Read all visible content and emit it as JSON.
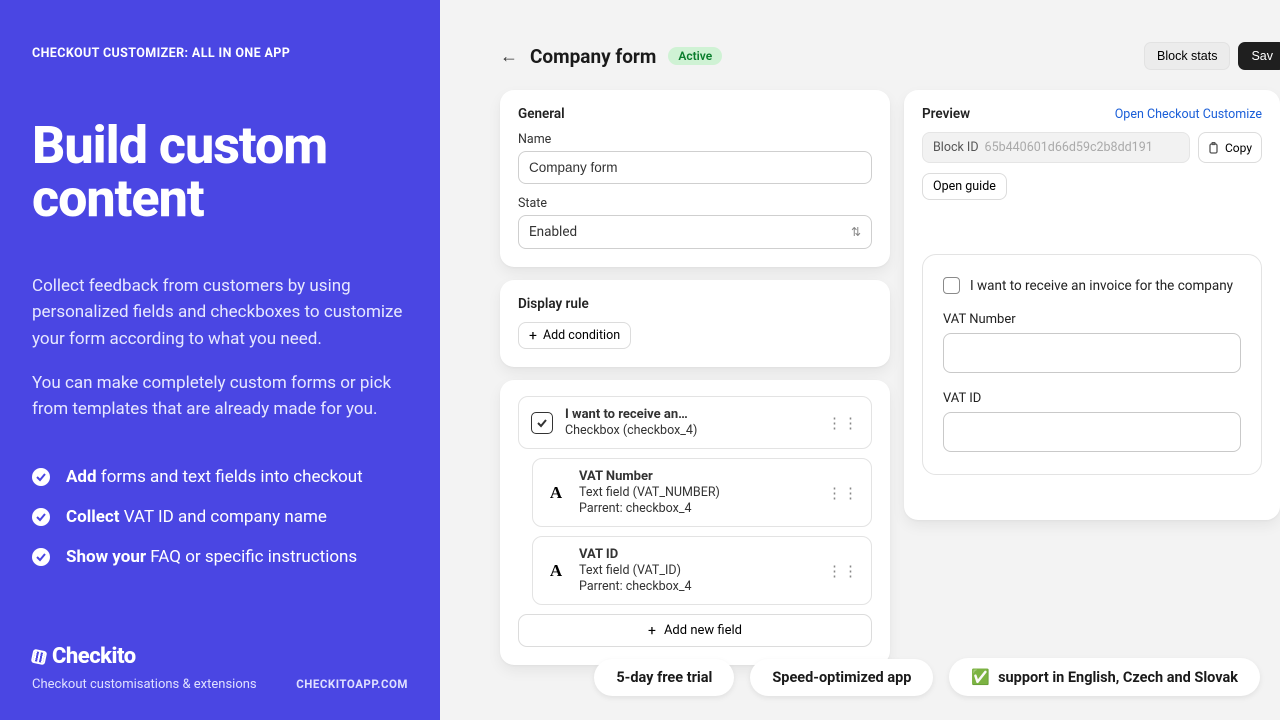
{
  "sidebar": {
    "eyebrow": "CHECKOUT CUSTOMIZER: ALL IN ONE APP",
    "headline": "Build custom content",
    "p1": "Collect feedback from customers by using personalized fields and checkboxes to customize your form according to what you need.",
    "p2": "You can make completely custom forms or pick from templates that are already made for you.",
    "bullets": [
      {
        "bold": "Add",
        "rest": " forms and text fields into checkout"
      },
      {
        "bold": "Collect",
        "rest": " VAT ID and company name"
      },
      {
        "bold": "Show your",
        "rest": " FAQ or specific instructions"
      }
    ],
    "brand": "Checkito",
    "tagline": "Checkout customisations & extensions",
    "domain": "CHECKITOAPP.COM"
  },
  "topbar": {
    "title": "Company form",
    "status": "Active",
    "block_stats": "Block stats",
    "save": "Sav"
  },
  "general": {
    "heading": "General",
    "name_label": "Name",
    "name_value": "Company form",
    "state_label": "State",
    "state_value": "Enabled"
  },
  "display_rule": {
    "heading": "Display rule",
    "add_condition": "Add condition"
  },
  "fields": {
    "items": [
      {
        "title": "I want to receive an…",
        "sub1": "Checkbox (checkbox_4)",
        "sub2": "",
        "kind": "checkbox"
      },
      {
        "title": "VAT Number",
        "sub1": "Text field (VAT_NUMBER)",
        "sub2": "Parrent: checkbox_4",
        "kind": "text"
      },
      {
        "title": "VAT ID",
        "sub1": "Text field (VAT_ID)",
        "sub2": "Parrent: checkbox_4",
        "kind": "text"
      }
    ],
    "add_new": "Add new field"
  },
  "preview": {
    "heading": "Preview",
    "open_customizer": "Open Checkout Customize",
    "block_id_label": "Block ID",
    "block_id_value": "65b440601d66d59c2b8dd191",
    "copy": "Copy",
    "open_guide": "Open guide",
    "checkbox_text": "I want to receive an invoice for the company",
    "vat_number_label": "VAT Number",
    "vat_id_label": "VAT ID"
  },
  "pills": {
    "a": "5-day free trial",
    "b": "Speed-optimized app",
    "c": "support in English, Czech and Slovak"
  }
}
